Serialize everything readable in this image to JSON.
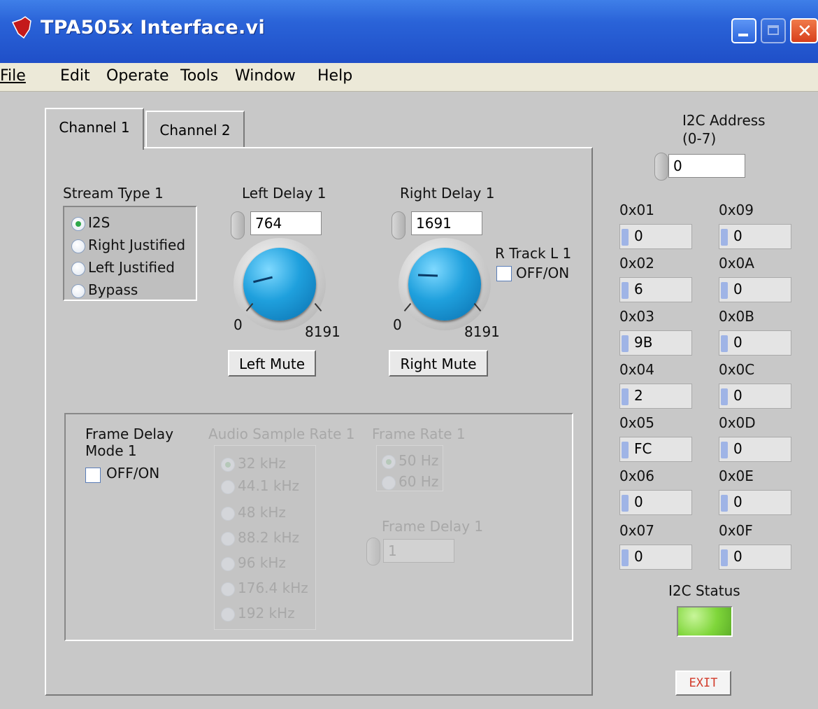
{
  "window": {
    "title": "TPA505x Interface.vi",
    "app_icon": "ti-logo-icon"
  },
  "menu": [
    "File",
    "Edit",
    "Operate",
    "Tools",
    "Window",
    "Help"
  ],
  "tabs": [
    "Channel 1",
    "Channel 2"
  ],
  "stream_type": {
    "label": "Stream Type 1",
    "options": [
      "I2S",
      "Right Justified",
      "Left Justified",
      "Bypass"
    ],
    "selected": "I2S"
  },
  "left_delay": {
    "label": "Left Delay 1",
    "value": "764",
    "min": "0",
    "max": "8191",
    "mute_label": "Left Mute"
  },
  "right_delay": {
    "label": "Right Delay 1",
    "value": "1691",
    "min": "0",
    "max": "8191",
    "mute_label": "Right Mute"
  },
  "r_track": {
    "label": "R Track L 1",
    "checkbox": "OFF/ON"
  },
  "frame_delay_mode": {
    "label_line1": "Frame Delay",
    "label_line2": "Mode 1",
    "checkbox": "OFF/ON"
  },
  "audio_sample_rate": {
    "label": "Audio Sample Rate 1",
    "options": [
      "32 kHz",
      "44.1 kHz",
      "48 kHz",
      "88.2 kHz",
      "96 kHz",
      "176.4 kHz",
      "192 kHz"
    ],
    "selected": "32 kHz"
  },
  "frame_rate": {
    "label": "Frame Rate 1",
    "options": [
      "50 Hz",
      "60 Hz"
    ],
    "selected": "50 Hz"
  },
  "frame_delay": {
    "label": "Frame Delay 1",
    "value": "1"
  },
  "i2c_address": {
    "label_line1": "I2C Address",
    "label_line2": "(0-7)",
    "value": "0"
  },
  "registers": {
    "left": [
      {
        "addr": "0x01",
        "value": "0"
      },
      {
        "addr": "0x02",
        "value": "6"
      },
      {
        "addr": "0x03",
        "value": "9B"
      },
      {
        "addr": "0x04",
        "value": "2"
      },
      {
        "addr": "0x05",
        "value": "FC"
      },
      {
        "addr": "0x06",
        "value": "0"
      },
      {
        "addr": "0x07",
        "value": "0"
      }
    ],
    "right": [
      {
        "addr": "0x09",
        "value": "0"
      },
      {
        "addr": "0x0A",
        "value": "0"
      },
      {
        "addr": "0x0B",
        "value": "0"
      },
      {
        "addr": "0x0C",
        "value": "0"
      },
      {
        "addr": "0x0D",
        "value": "0"
      },
      {
        "addr": "0x0E",
        "value": "0"
      },
      {
        "addr": "0x0F",
        "value": "0"
      }
    ]
  },
  "i2c_status": {
    "label": "I2C Status",
    "color": "#7fd63a"
  },
  "exit_label": "EXIT",
  "colors": {
    "titlebar": "#2a63d8",
    "knob": "#1fa0dd",
    "exit_text": "#d23a2a"
  }
}
